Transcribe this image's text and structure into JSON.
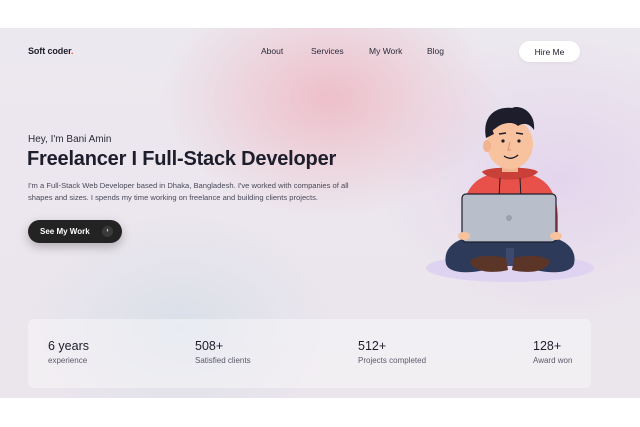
{
  "brand": {
    "name": "Soft coder",
    "dot": ".",
    "accent_color": "#f05a28"
  },
  "nav": {
    "items": [
      {
        "label": "About"
      },
      {
        "label": "Services"
      },
      {
        "label": "My Work"
      },
      {
        "label": "Blog"
      }
    ],
    "hire_button": "Hire Me"
  },
  "hero": {
    "greeting": "Hey, I'm Bani Amin",
    "headline": "Freelancer I Full-Stack Developer",
    "description": "I'm a Full-Stack Web Developer based in Dhaka, Bangladesh. I've worked with companies of all shapes and sizes. I spends my time working on freelance and building clients projects.",
    "cta_label": "See My Work",
    "cta_arrow": "›",
    "illustration_icon": "developer-with-laptop-icon"
  },
  "stats": [
    {
      "value": "6 years",
      "label": "experience"
    },
    {
      "value": "508+",
      "label": "Satisfied clients"
    },
    {
      "value": "512+",
      "label": "Projects completed"
    },
    {
      "value": "128+",
      "label": "Award won"
    }
  ],
  "colors": {
    "primary_dark": "#232323",
    "hoodie": "#e8514a",
    "laptop": "#b9bfca",
    "pants": "#2e3a5a"
  }
}
